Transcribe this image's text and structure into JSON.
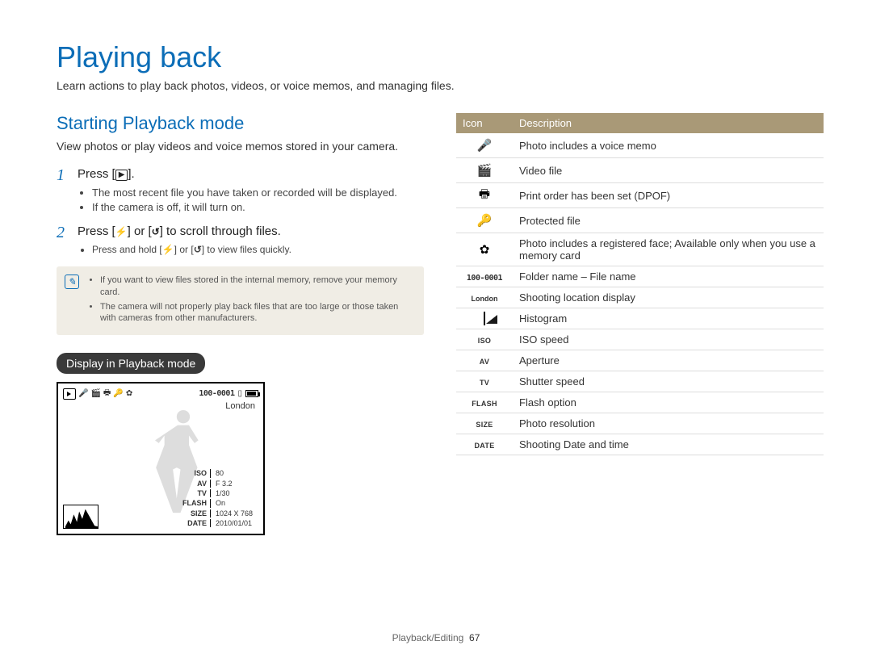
{
  "page": {
    "title": "Playing back",
    "intro": "Learn actions to play back photos, videos, or voice memos, and managing files."
  },
  "left": {
    "h2": "Starting Playback mode",
    "desc": "View photos or play videos and voice memos stored in your camera.",
    "step1": {
      "num": "1",
      "prefix": "Press [",
      "suffix": "]."
    },
    "step1_sub": [
      "The most recent file you have taken or recorded will be displayed.",
      "If the camera is off, it will turn on."
    ],
    "step2": {
      "num": "2",
      "prefix": "Press [",
      "mid": "] or [",
      "suffix": "] to scroll through files."
    },
    "step2_sub_prefix": "Press and hold [",
    "step2_sub_mid": "] or [",
    "step2_sub_suffix": "] to view files quickly.",
    "note": [
      "If you want to view files stored in the internal memory, remove your memory card.",
      "The camera will not properly play back files that are too large or those taken with cameras from other manufacturers."
    ],
    "pill": "Display in Playback mode",
    "display": {
      "folder": "100-0001",
      "location": "London",
      "meta": {
        "ISO": "80",
        "AV": "F 3.2",
        "TV": "1/30",
        "FLASH": "On",
        "SIZE": "1024 X 768",
        "DATE": "2010/01/01"
      }
    }
  },
  "table": {
    "head_icon": "Icon",
    "head_desc": "Description",
    "rows": [
      {
        "kind": "glyph",
        "glyph": "🎤",
        "name": "voice-memo-icon",
        "desc": "Photo includes a voice memo"
      },
      {
        "kind": "glyph",
        "glyph": "🎬",
        "name": "video-file-icon",
        "desc": "Video file"
      },
      {
        "kind": "glyph",
        "glyph": "🖶",
        "name": "print-order-icon",
        "desc": "Print order has been set (DPOF)"
      },
      {
        "kind": "glyph",
        "glyph": "🔑",
        "name": "protected-file-icon",
        "desc": "Protected file"
      },
      {
        "kind": "glyph",
        "glyph": "✿",
        "name": "registered-face-icon",
        "desc": "Photo includes a registered face; Available only when you use a memory card"
      },
      {
        "kind": "folder",
        "text": "100-0001",
        "name": "folder-file-name-icon",
        "desc": "Folder name – File name"
      },
      {
        "kind": "textlabel",
        "text": "London",
        "name": "location-label-icon",
        "desc": "Shooting location display"
      },
      {
        "kind": "histogram",
        "name": "histogram-icon",
        "desc": "Histogram"
      },
      {
        "kind": "smalllabel",
        "text": "ISO",
        "name": "iso-label-icon",
        "desc": "ISO speed"
      },
      {
        "kind": "smalllabel",
        "text": "AV",
        "name": "av-label-icon",
        "desc": "Aperture"
      },
      {
        "kind": "smalllabel",
        "text": "TV",
        "name": "tv-label-icon",
        "desc": "Shutter speed"
      },
      {
        "kind": "smalllabel",
        "text": "FLASH",
        "name": "flash-label-icon",
        "desc": "Flash option"
      },
      {
        "kind": "smalllabel",
        "text": "SIZE",
        "name": "size-label-icon",
        "desc": "Photo resolution"
      },
      {
        "kind": "smalllabel",
        "text": "DATE",
        "name": "date-label-icon",
        "desc": "Shooting Date and time"
      }
    ]
  },
  "footer": {
    "section": "Playback/Editing",
    "page": "67"
  }
}
